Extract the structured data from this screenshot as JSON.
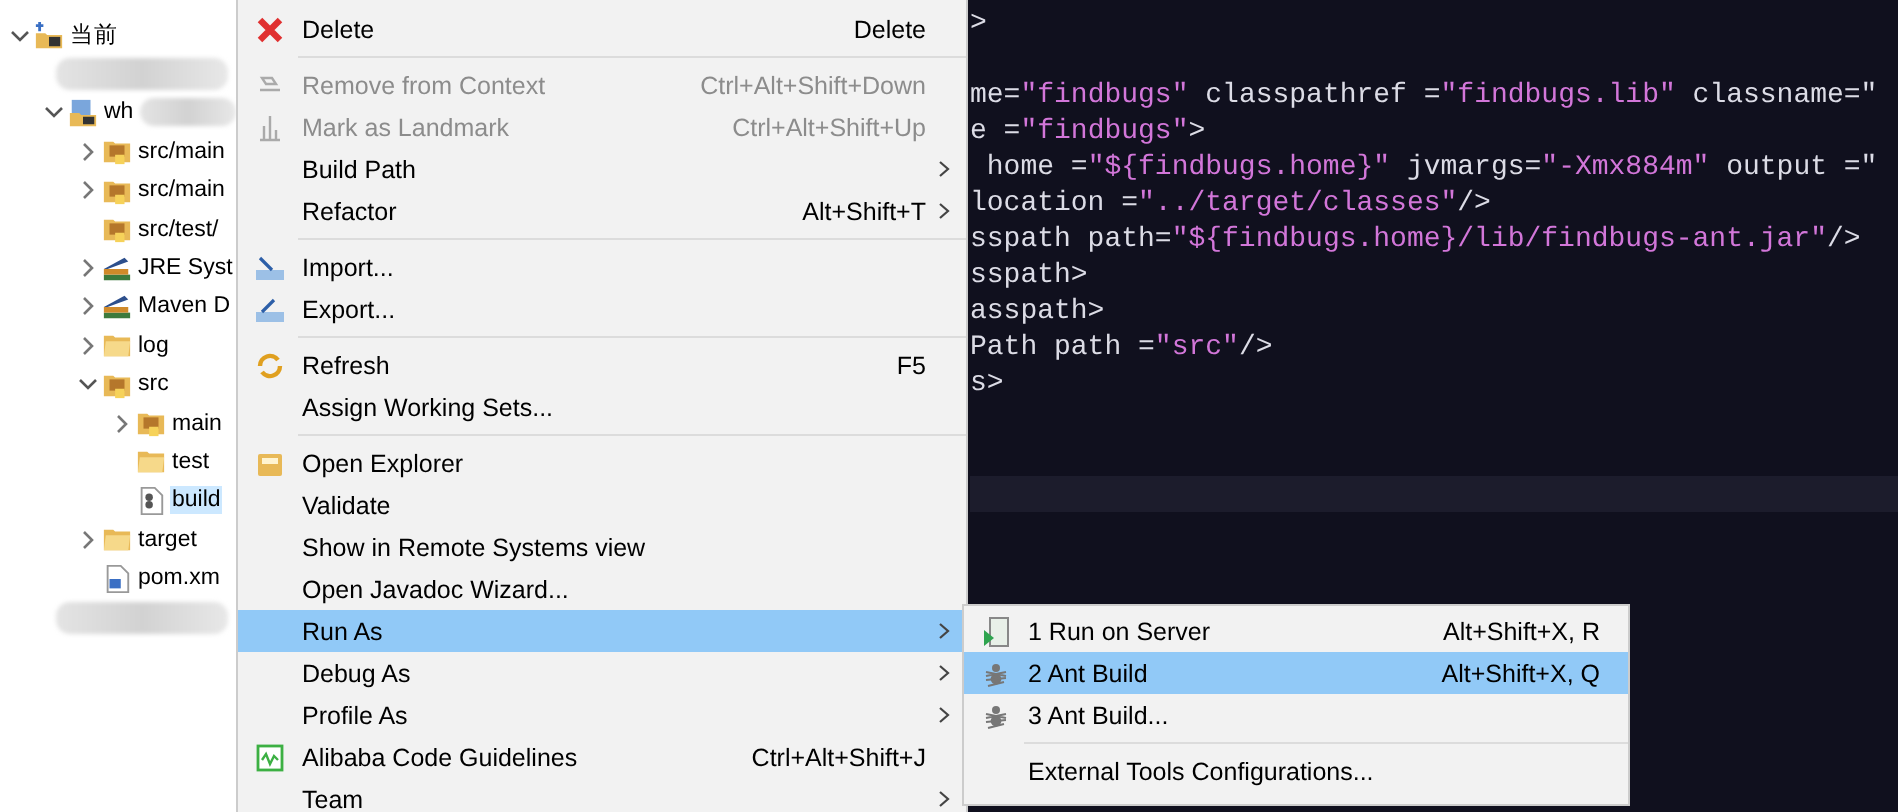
{
  "tree": [
    {
      "label": "当前",
      "kind": "working-set",
      "expanded": true,
      "children": [
        {
          "kind": "redacted"
        },
        {
          "label": "wh",
          "kind": "project",
          "expanded": true,
          "redacted": true,
          "children": [
            {
              "label": "src/main",
              "kind": "package-folder",
              "expanded": false
            },
            {
              "label": "src/main",
              "kind": "package-folder",
              "expanded": false
            },
            {
              "label": "src/test/",
              "kind": "package-folder"
            },
            {
              "label": "JRE Syst",
              "kind": "library",
              "expanded": false
            },
            {
              "label": "Maven D",
              "kind": "library",
              "expanded": false
            },
            {
              "label": "log",
              "kind": "folder",
              "expanded": false
            },
            {
              "label": "src",
              "kind": "package-folder",
              "expanded": true,
              "children": [
                {
                  "label": "main",
                  "kind": "package-folder",
                  "expanded": false
                },
                {
                  "label": "test",
                  "kind": "folder"
                },
                {
                  "label": "build",
                  "kind": "ant-file",
                  "selected": true
                }
              ]
            },
            {
              "label": "target",
              "kind": "folder",
              "expanded": false
            },
            {
              "label": "pom.xm",
              "kind": "xml-file"
            }
          ]
        },
        {
          "kind": "redacted"
        }
      ]
    }
  ],
  "code_lines": [
    [
      {
        "text": ">",
        "kind": "plain"
      }
    ],
    [
      {
        "text": "me=",
        "kind": "plain"
      },
      {
        "text": "\"findbugs\"",
        "kind": "string"
      },
      {
        "text": " classpathref =",
        "kind": "plain"
      },
      {
        "text": "\"findbugs.lib\"",
        "kind": "string"
      },
      {
        "text": " classname=\"",
        "kind": "plain"
      }
    ],
    [
      {
        "text": "e =",
        "kind": "plain"
      },
      {
        "text": "\"findbugs\"",
        "kind": "string"
      },
      {
        "text": ">",
        "kind": "plain"
      }
    ],
    [
      {
        "text": " home =",
        "kind": "plain"
      },
      {
        "text": "\"${findbugs.home}\"",
        "kind": "string"
      },
      {
        "text": " jvmargs=",
        "kind": "plain"
      },
      {
        "text": "\"-Xmx884m\"",
        "kind": "string"
      },
      {
        "text": " output =\"",
        "kind": "plain"
      }
    ],
    [
      {
        "text": "location =",
        "kind": "plain"
      },
      {
        "text": "\"../target/classes\"",
        "kind": "string"
      },
      {
        "text": "/>",
        "kind": "plain"
      }
    ],
    [
      {
        "text": "sspath path=",
        "kind": "plain"
      },
      {
        "text": "\"${findbugs.home}/lib/findbugs-ant.jar\"",
        "kind": "string"
      },
      {
        "text": "/>",
        "kind": "plain"
      }
    ],
    [
      {
        "text": "sspath>",
        "kind": "plain"
      }
    ],
    [
      {
        "text": "asspath>",
        "kind": "plain"
      }
    ],
    [
      {
        "text": "Path path =",
        "kind": "plain"
      },
      {
        "text": "\"src\"",
        "kind": "string"
      },
      {
        "text": "/>",
        "kind": "plain"
      }
    ],
    [
      {
        "text": "s>",
        "kind": "plain"
      }
    ]
  ],
  "context_menu": [
    {
      "kind": "delete",
      "label": "Delete",
      "shortcut": "Delete",
      "disabled": false,
      "submenu": false,
      "selected": false
    },
    {
      "kind": "separator"
    },
    {
      "kind": "remove-context",
      "label": "Remove from Context",
      "shortcut": "Ctrl+Alt+Shift+Down",
      "disabled": true,
      "submenu": false,
      "selected": false
    },
    {
      "kind": "landmark",
      "label": "Mark as Landmark",
      "shortcut": "Ctrl+Alt+Shift+Up",
      "disabled": true,
      "submenu": false,
      "selected": false
    },
    {
      "kind": "item",
      "label": "Build Path",
      "disabled": false,
      "submenu": true,
      "selected": false
    },
    {
      "kind": "item",
      "label": "Refactor",
      "shortcut": "Alt+Shift+T",
      "disabled": false,
      "submenu": true,
      "selected": false
    },
    {
      "kind": "separator"
    },
    {
      "kind": "import",
      "label": "Import...",
      "disabled": false,
      "submenu": false,
      "selected": false
    },
    {
      "kind": "export",
      "label": "Export...",
      "disabled": false,
      "submenu": false,
      "selected": false
    },
    {
      "kind": "separator"
    },
    {
      "kind": "refresh",
      "label": "Refresh",
      "shortcut": "F5",
      "disabled": false,
      "submenu": false,
      "selected": false
    },
    {
      "kind": "item",
      "label": "Assign Working Sets...",
      "disabled": false,
      "submenu": false,
      "selected": false
    },
    {
      "kind": "separator"
    },
    {
      "kind": "explorer",
      "label": "Open Explorer",
      "disabled": false,
      "submenu": false,
      "selected": false
    },
    {
      "kind": "item",
      "label": "Validate",
      "disabled": false,
      "submenu": false,
      "selected": false
    },
    {
      "kind": "item",
      "label": "Show in Remote Systems view",
      "disabled": false,
      "submenu": false,
      "selected": false
    },
    {
      "kind": "item",
      "label": "Open Javadoc Wizard...",
      "disabled": false,
      "submenu": false,
      "selected": false
    },
    {
      "kind": "item",
      "label": "Run As",
      "disabled": false,
      "submenu": true,
      "selected": true
    },
    {
      "kind": "item",
      "label": "Debug As",
      "disabled": false,
      "submenu": true,
      "selected": false
    },
    {
      "kind": "item",
      "label": "Profile As",
      "disabled": false,
      "submenu": true,
      "selected": false
    },
    {
      "kind": "guidelines",
      "label": "Alibaba Code Guidelines",
      "shortcut": "Ctrl+Alt+Shift+J",
      "disabled": false,
      "submenu": false,
      "selected": false
    },
    {
      "kind": "item",
      "label": "Team",
      "disabled": false,
      "submenu": true,
      "selected": false
    }
  ],
  "submenu": [
    {
      "kind": "run-server",
      "label": "1 Run on Server",
      "shortcut": "Alt+Shift+X, R",
      "selected": false
    },
    {
      "kind": "ant",
      "label": "2 Ant Build",
      "shortcut": "Alt+Shift+X, Q",
      "selected": true
    },
    {
      "kind": "ant",
      "label": "3 Ant Build...",
      "selected": false
    },
    {
      "kind": "separator"
    },
    {
      "kind": "item",
      "label": "External Tools Configurations...",
      "selected": false
    }
  ]
}
